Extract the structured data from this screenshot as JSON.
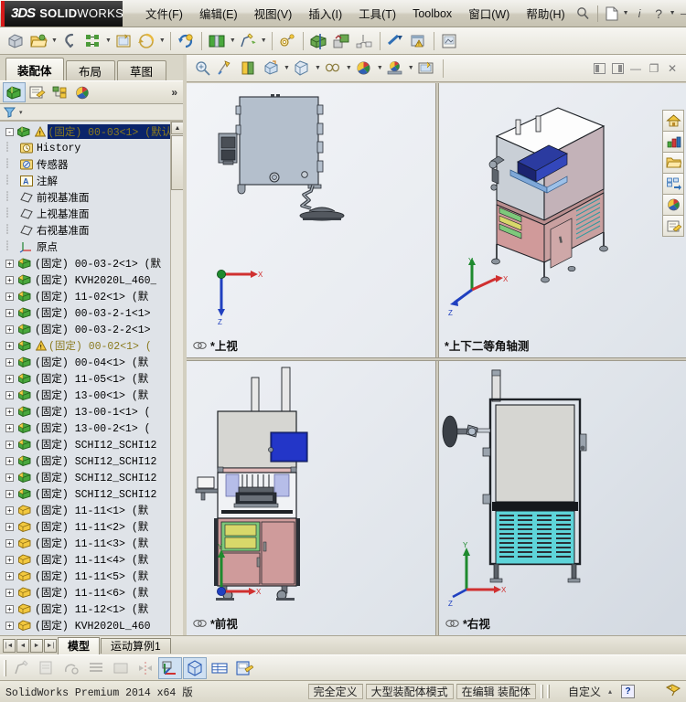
{
  "app": {
    "brand_ds": "3DS",
    "brand_name_bold": "SOLID",
    "brand_name_light": "WORKS",
    "accent_red": "#d61a1a"
  },
  "menubar": {
    "items": [
      {
        "label": "文件(F)",
        "name": "menu-file"
      },
      {
        "label": "编辑(E)",
        "name": "menu-edit"
      },
      {
        "label": "视图(V)",
        "name": "menu-view"
      },
      {
        "label": "插入(I)",
        "name": "menu-insert"
      },
      {
        "label": "工具(T)",
        "name": "menu-tools"
      },
      {
        "label": "Toolbox",
        "name": "menu-toolbox"
      },
      {
        "label": "窗口(W)",
        "name": "menu-window"
      },
      {
        "label": "帮助(H)",
        "name": "menu-help"
      }
    ],
    "search_icon": "search-icon",
    "new_doc_icon": "new-document-icon",
    "info_icon": "info-icon",
    "help_icon": "help-icon",
    "minimize": "—",
    "restore": "❐",
    "close": "✕"
  },
  "main_toolbar": {
    "icons": [
      "new-assembly-icon",
      "open-folder-icon",
      "open-dropdown-caret",
      "save-icon",
      "print-icon",
      "print-dropdown-caret",
      "print-preview-icon",
      "undo-icon",
      "undo-dropdown-caret",
      "rebuild-icon",
      "edit-component-icon",
      "edit-dropdown-caret",
      "new-sketch-icon",
      "sketch-dropdown-caret",
      "measure-icon",
      "section-view-icon",
      "mate-icon",
      "exploded-view-icon",
      "interference-icon",
      "assembly-warning-icon",
      "drawing-icon"
    ]
  },
  "left_panel": {
    "tabs": [
      {
        "label": "装配体",
        "name": "panel-tab-assembly",
        "active": true
      },
      {
        "label": "布局",
        "name": "panel-tab-layout",
        "active": false
      },
      {
        "label": "草图",
        "name": "panel-tab-sketch",
        "active": false
      }
    ],
    "manager_icons": [
      {
        "name": "feature-manager-icon",
        "selected": true
      },
      {
        "name": "property-manager-icon",
        "selected": false
      },
      {
        "name": "configuration-manager-icon",
        "selected": false
      },
      {
        "name": "display-manager-icon",
        "selected": false
      }
    ],
    "expand_chevron": "»",
    "filter_icon": "filter-icon",
    "filter_caret": "▾"
  },
  "feature_tree": {
    "root": {
      "label": "(固定) 00-03<1>  (默认",
      "selected": true,
      "warning": true,
      "icon": "assembly-icon",
      "expander": "-"
    },
    "children": [
      {
        "label": "History",
        "icon": "history-icon",
        "indent": 1,
        "expander": null
      },
      {
        "label": "传感器",
        "icon": "sensor-icon",
        "indent": 1,
        "expander": null
      },
      {
        "label": "注解",
        "icon": "annotation-icon",
        "indent": 1,
        "expander": null
      },
      {
        "label": "前视基准面",
        "icon": "plane-icon",
        "indent": 1,
        "expander": null
      },
      {
        "label": "上视基准面",
        "icon": "plane-icon",
        "indent": 1,
        "expander": null
      },
      {
        "label": "右视基准面",
        "icon": "plane-icon",
        "indent": 1,
        "expander": null
      },
      {
        "label": "原点",
        "icon": "origin-icon",
        "indent": 1,
        "expander": null
      },
      {
        "label": "(固定) 00-03-2<1>  (默",
        "icon": "part-green-icon",
        "indent": 1,
        "expander": "+"
      },
      {
        "label": "(固定) KVH2020L_460_",
        "icon": "part-green-icon",
        "indent": 1,
        "expander": "+"
      },
      {
        "label": "(固定) 11-02<1>  (默",
        "icon": "part-green-icon",
        "indent": 1,
        "expander": "+"
      },
      {
        "label": "(固定) 00-03-2-1<1>",
        "icon": "part-green-icon",
        "indent": 1,
        "expander": "+"
      },
      {
        "label": "(固定) 00-03-2-2<1>",
        "icon": "part-green-icon",
        "indent": 1,
        "expander": "+"
      },
      {
        "label": "(固定) 00-02<1>  (",
        "icon": "part-green-icon",
        "indent": 1,
        "expander": "+",
        "warning": true
      },
      {
        "label": "(固定) 00-04<1>  (默",
        "icon": "part-green-icon",
        "indent": 1,
        "expander": "+"
      },
      {
        "label": "(固定) 11-05<1>  (默",
        "icon": "part-green-icon",
        "indent": 1,
        "expander": "+"
      },
      {
        "label": "(固定) 13-00<1>  (默",
        "icon": "part-green-icon",
        "indent": 1,
        "expander": "+"
      },
      {
        "label": "(固定) 13-00-1<1>  (",
        "icon": "part-green-icon",
        "indent": 1,
        "expander": "+"
      },
      {
        "label": "(固定) 13-00-2<1>  (",
        "icon": "part-green-icon",
        "indent": 1,
        "expander": "+"
      },
      {
        "label": "(固定) SCHI12_SCHI12",
        "icon": "part-green-icon",
        "indent": 1,
        "expander": "+"
      },
      {
        "label": "(固定) SCHI12_SCHI12",
        "icon": "part-green-icon",
        "indent": 1,
        "expander": "+"
      },
      {
        "label": "(固定) SCHI12_SCHI12",
        "icon": "part-green-icon",
        "indent": 1,
        "expander": "+"
      },
      {
        "label": "(固定) SCHI12_SCHI12",
        "icon": "part-green-icon",
        "indent": 1,
        "expander": "+"
      },
      {
        "label": "(固定) 11-11<1>  (默",
        "icon": "part-yellow-icon",
        "indent": 1,
        "expander": "+"
      },
      {
        "label": "(固定) 11-11<2>  (默",
        "icon": "part-yellow-icon",
        "indent": 1,
        "expander": "+"
      },
      {
        "label": "(固定) 11-11<3>  (默",
        "icon": "part-yellow-icon",
        "indent": 1,
        "expander": "+"
      },
      {
        "label": "(固定) 11-11<4>  (默",
        "icon": "part-yellow-icon",
        "indent": 1,
        "expander": "+"
      },
      {
        "label": "(固定) 11-11<5>  (默",
        "icon": "part-yellow-icon",
        "indent": 1,
        "expander": "+"
      },
      {
        "label": "(固定) 11-11<6>  (默",
        "icon": "part-yellow-icon",
        "indent": 1,
        "expander": "+"
      },
      {
        "label": "(固定) 11-12<1>  (默",
        "icon": "part-yellow-icon",
        "indent": 1,
        "expander": "+"
      },
      {
        "label": "(固定) KVH2020L_460",
        "icon": "part-yellow-icon",
        "indent": 1,
        "expander": "+"
      }
    ]
  },
  "view_toolbar": {
    "icons": [
      "zoom-to-fit-icon",
      "zoom-to-area-icon",
      "previous-view-icon",
      "section-view-icon",
      "view-orientation-icon",
      "orientation-caret",
      "display-style-icon",
      "display-caret",
      "hide-show-icon",
      "hide-caret",
      "appearance-icon",
      "appearance-caret",
      "scene-icon",
      "scene-caret",
      "view-settings-icon"
    ],
    "window_buttons": [
      "split-left-icon",
      "split-right-icon",
      "minimize-icon",
      "restore-icon",
      "close-icon"
    ]
  },
  "right_toolbar": {
    "icons": [
      "home-icon",
      "resources-icon",
      "file-explorer-icon",
      "design-library-icon",
      "appearances-icon",
      "custom-properties-icon"
    ]
  },
  "viewports": [
    {
      "name": "viewport-top",
      "label": "*上视",
      "lock_icon": "orientation-lock-icon",
      "triad": {
        "x_label": "X",
        "y_label": "",
        "z_label": "Z"
      }
    },
    {
      "name": "viewport-isometric",
      "label": "*上下二等角轴测",
      "lock_icon": "none",
      "triad": {
        "x_label": "X",
        "y_label": "Y",
        "z_label": "Z"
      }
    },
    {
      "name": "viewport-front",
      "label": "*前视",
      "lock_icon": "orientation-lock-icon",
      "triad": {
        "x_label": "X",
        "y_label": "Y",
        "z_label": ""
      }
    },
    {
      "name": "viewport-right",
      "label": "*右视",
      "lock_icon": "orientation-lock-icon",
      "triad": {
        "x_label": "X",
        "y_label": "Y",
        "z_label": "Z"
      }
    }
  ],
  "bottom_tabs": {
    "nav_buttons": [
      "first-icon",
      "previous-icon",
      "next-icon",
      "last-icon"
    ],
    "tabs": [
      {
        "label": "模型",
        "name": "bottom-tab-model",
        "active": true
      },
      {
        "label": "运动算例1",
        "name": "bottom-tab-motion",
        "active": false
      }
    ]
  },
  "bottom_toolbar": {
    "icons": [
      {
        "name": "edit-sketch-icon",
        "selected": false,
        "disabled": true
      },
      {
        "name": "edit-part-icon",
        "selected": false,
        "disabled": true
      },
      {
        "name": "smart-dimension-icon",
        "selected": false,
        "disabled": true
      },
      {
        "name": "line-style-icon",
        "selected": false,
        "disabled": true
      },
      {
        "name": "shaded-sketch-icon",
        "selected": false,
        "disabled": true
      },
      {
        "name": "mirror-icon",
        "selected": false,
        "disabled": true
      },
      {
        "name": "reference-geometry-icon",
        "selected": true,
        "disabled": false
      },
      {
        "name": "isometric-view-icon",
        "selected": true,
        "disabled": false
      },
      {
        "name": "table-icon",
        "selected": false,
        "disabled": false
      },
      {
        "name": "save-sheet-icon",
        "selected": false,
        "disabled": false
      }
    ]
  },
  "status_bar": {
    "product": "SolidWorks Premium 2014 x64 版",
    "cells": [
      {
        "label": "完全定义",
        "name": "status-fully-defined"
      },
      {
        "label": "大型装配体模式",
        "name": "status-large-assembly"
      },
      {
        "label": "在编辑 装配体",
        "name": "status-editing-assembly"
      }
    ],
    "customize_label": "自定义",
    "caret": "▴",
    "help_glyph": "?",
    "tag_icon": "tag-icon"
  }
}
